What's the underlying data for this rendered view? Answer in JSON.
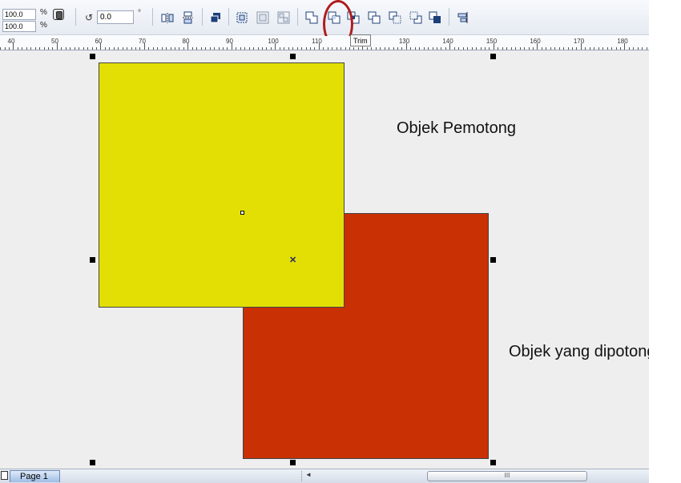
{
  "property_bar": {
    "scale_x": "100.0",
    "scale_y": "100.0",
    "percent_unit": "%",
    "rotation_value": "0.0",
    "rotation_unit": "°",
    "tooltip": "Trim"
  },
  "ruler": {
    "labels": [
      "40",
      "50",
      "60",
      "70",
      "80",
      "90",
      "100",
      "110",
      "120",
      "130",
      "140",
      "150",
      "160",
      "170",
      "180"
    ]
  },
  "canvas": {
    "label_cutter": "Objek Pemotong",
    "label_target": "Objek yang dipotong",
    "colors": {
      "yellow": "#e3df05",
      "red": "#c93004",
      "background": "#eeeeee"
    }
  },
  "status": {
    "page_tab": "Page 1",
    "scroll_grip": "III"
  },
  "icons": [
    "lock-ratio-icon",
    "rotate-icon",
    "mirror-horizontal-icon",
    "mirror-vertical-icon",
    "combine-icon",
    "group-icon",
    "ungroup-icon",
    "ungroup-all-icon",
    "weld-icon",
    "trim-icon",
    "intersect-icon",
    "simplify-icon",
    "front-minus-back-icon",
    "back-minus-front-icon",
    "create-boundary-icon",
    "align-distribute-icon"
  ]
}
